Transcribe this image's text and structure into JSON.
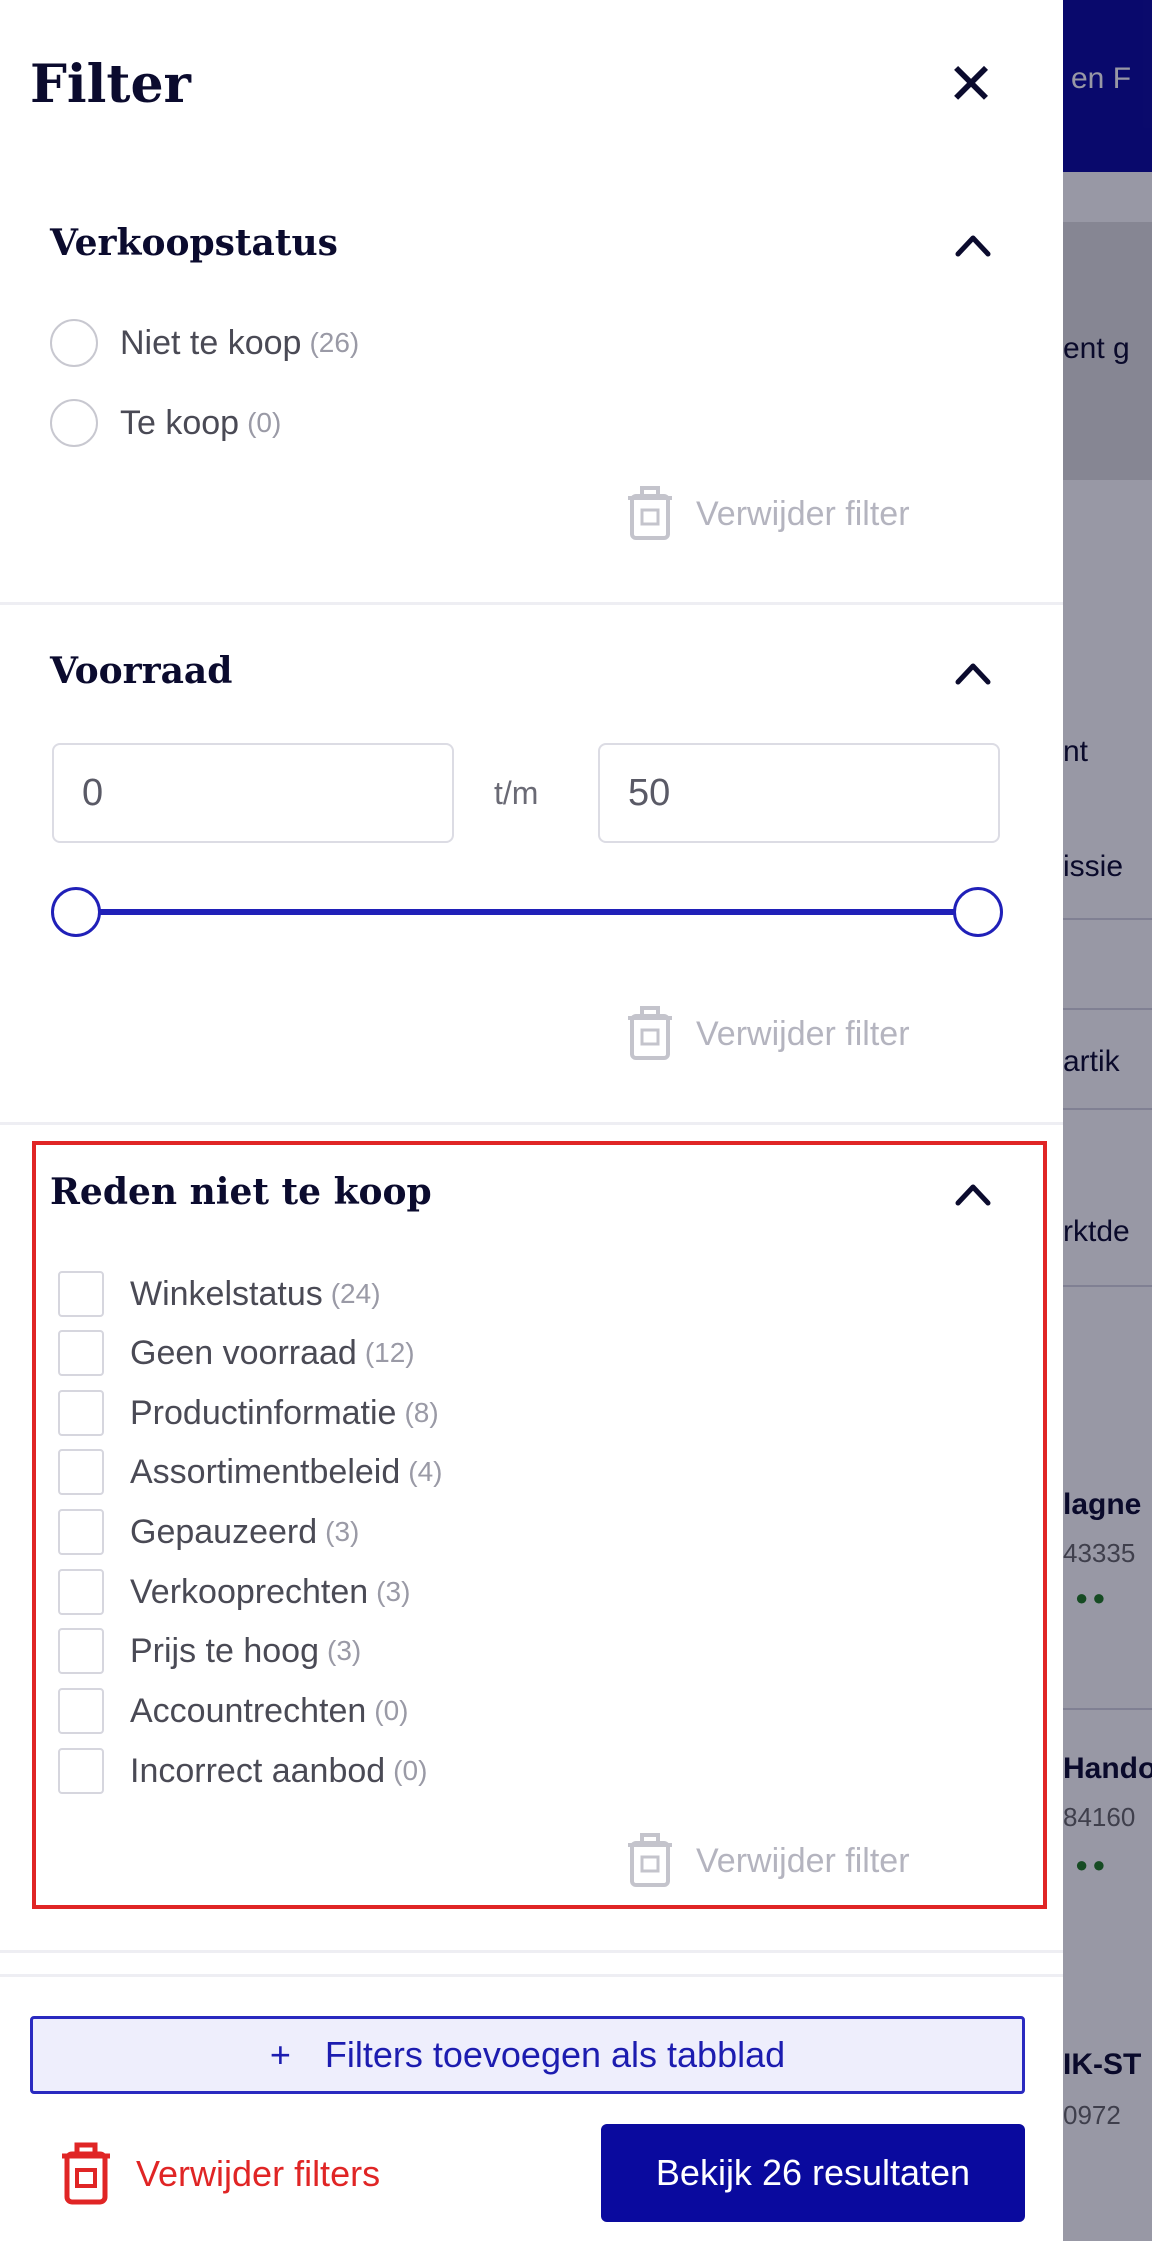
{
  "drawer": {
    "title": "Filter",
    "close_icon": "close-icon"
  },
  "sections": {
    "sale_status": {
      "title": "Verkoopstatus",
      "options": [
        {
          "label": "Niet te koop",
          "count": "(26)"
        },
        {
          "label": "Te koop",
          "count": "(0)"
        }
      ],
      "remove_label": "Verwijder filter"
    },
    "stock": {
      "title": "Voorraad",
      "min_value": "0",
      "max_value": "50",
      "separator": "t/m",
      "slider_min_fraction": 0,
      "slider_max_fraction": 1,
      "remove_label": "Verwijder filter"
    },
    "reason": {
      "title": "Reden niet te koop",
      "options": [
        {
          "label": "Winkelstatus",
          "count": "(24)"
        },
        {
          "label": "Geen voorraad",
          "count": "(12)"
        },
        {
          "label": "Productinformatie",
          "count": "(8)"
        },
        {
          "label": "Assortimentbeleid",
          "count": "(4)"
        },
        {
          "label": "Gepauzeerd",
          "count": "(3)"
        },
        {
          "label": "Verkooprechten",
          "count": "(3)"
        },
        {
          "label": "Prijs te hoog",
          "count": "(3)"
        },
        {
          "label": "Accountrechten",
          "count": "(0)"
        },
        {
          "label": "Incorrect aanbod",
          "count": "(0)"
        }
      ],
      "remove_label": "Verwijder filter"
    }
  },
  "footer": {
    "add_tab_label": "Filters toevoegen als tabblad",
    "add_tab_icon": "+",
    "remove_all_label": "Verwijder filters",
    "view_results_label": "Bekijk 26 resultaten"
  },
  "background_page": {
    "header_text": "en  F",
    "banner_text": "ent g",
    "snippets": [
      "nt",
      "issie",
      "artik",
      "rktde",
      "lagne",
      "43335",
      "Hando",
      "84160",
      "IK-ST",
      "0972"
    ]
  },
  "colors": {
    "brand": "#0a0a9e",
    "highlight": "#e02525",
    "danger": "#e02525"
  }
}
